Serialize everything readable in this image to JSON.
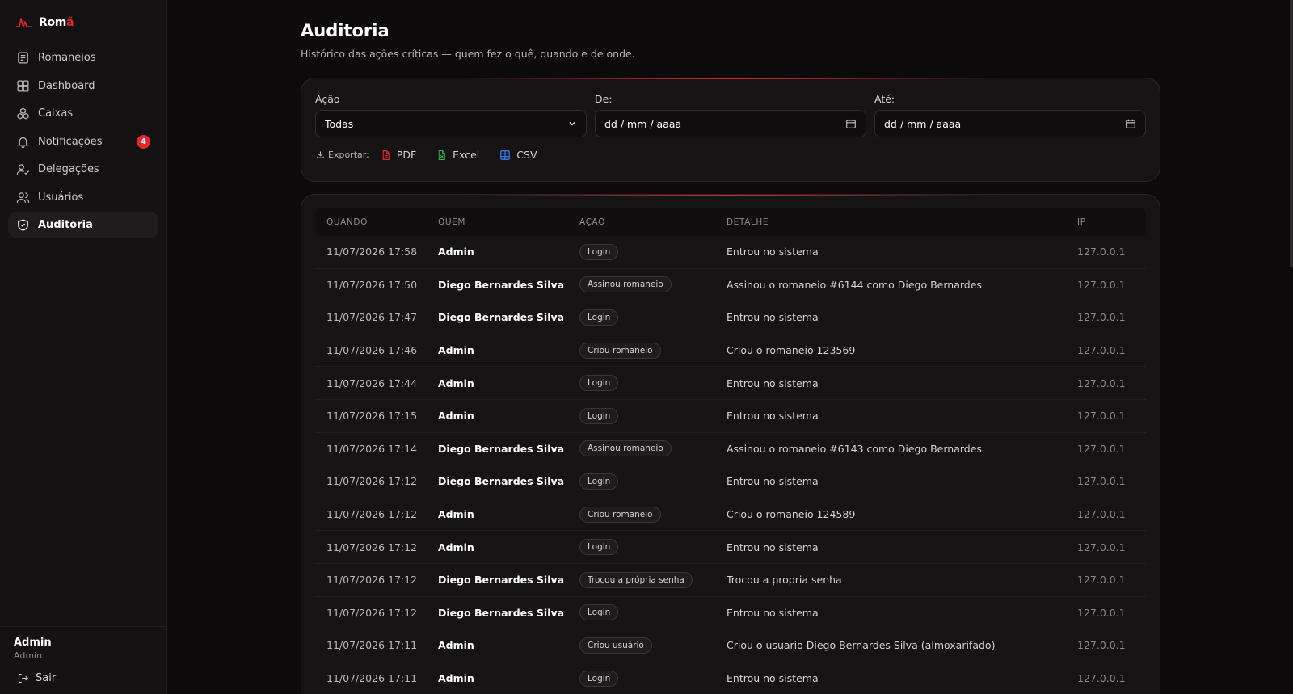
{
  "brand": {
    "name": "Rom",
    "accent_letter": "ã"
  },
  "sidebar": {
    "items": [
      {
        "label": "Romaneios",
        "icon": "receipt-icon"
      },
      {
        "label": "Dashboard",
        "icon": "dashboard-icon"
      },
      {
        "label": "Caixas",
        "icon": "boxes-icon"
      },
      {
        "label": "Notificações",
        "icon": "bell-icon",
        "badge": "4"
      },
      {
        "label": "Delegações",
        "icon": "user-check-icon"
      },
      {
        "label": "Usuários",
        "icon": "users-icon"
      },
      {
        "label": "Auditoria",
        "icon": "shield-icon",
        "active": true
      }
    ],
    "user": {
      "name": "Admin",
      "role": "Admin"
    },
    "logout_label": "Sair"
  },
  "page": {
    "title": "Auditoria",
    "subtitle": "Histórico das ações críticas — quem fez o quê, quando e de onde."
  },
  "filters": {
    "action_label": "Ação",
    "action_value": "Todas",
    "from_label": "De:",
    "from_placeholder": "dd / mm / aaaa",
    "to_label": "Até:",
    "to_placeholder": "dd / mm / aaaa",
    "export_label": "Exportar:",
    "export_pdf": "PDF",
    "export_excel": "Excel",
    "export_csv": "CSV"
  },
  "table": {
    "headers": [
      "QUANDO",
      "QUEM",
      "AÇÃO",
      "DETALHE",
      "IP"
    ],
    "rows": [
      [
        "11/07/2026 17:58",
        "Admin",
        "Login",
        "Entrou no sistema",
        "127.0.0.1"
      ],
      [
        "11/07/2026 17:50",
        "Diego Bernardes Silva",
        "Assinou romaneio",
        "Assinou o romaneio #6144 como Diego Bernardes",
        "127.0.0.1"
      ],
      [
        "11/07/2026 17:47",
        "Diego Bernardes Silva",
        "Login",
        "Entrou no sistema",
        "127.0.0.1"
      ],
      [
        "11/07/2026 17:46",
        "Admin",
        "Criou romaneio",
        "Criou o romaneio 123569",
        "127.0.0.1"
      ],
      [
        "11/07/2026 17:44",
        "Admin",
        "Login",
        "Entrou no sistema",
        "127.0.0.1"
      ],
      [
        "11/07/2026 17:15",
        "Admin",
        "Login",
        "Entrou no sistema",
        "127.0.0.1"
      ],
      [
        "11/07/2026 17:14",
        "Diego Bernardes Silva",
        "Assinou romaneio",
        "Assinou o romaneio #6143 como Diego Bernardes",
        "127.0.0.1"
      ],
      [
        "11/07/2026 17:12",
        "Diego Bernardes Silva",
        "Login",
        "Entrou no sistema",
        "127.0.0.1"
      ],
      [
        "11/07/2026 17:12",
        "Admin",
        "Criou romaneio",
        "Criou o romaneio 124589",
        "127.0.0.1"
      ],
      [
        "11/07/2026 17:12",
        "Admin",
        "Login",
        "Entrou no sistema",
        "127.0.0.1"
      ],
      [
        "11/07/2026 17:12",
        "Diego Bernardes Silva",
        "Trocou a própria senha",
        "Trocou a propria senha",
        "127.0.0.1"
      ],
      [
        "11/07/2026 17:12",
        "Diego Bernardes Silva",
        "Login",
        "Entrou no sistema",
        "127.0.0.1"
      ],
      [
        "11/07/2026 17:11",
        "Admin",
        "Criou usuário",
        "Criou o usuario Diego Bernardes Silva (almoxarifado)",
        "127.0.0.1"
      ],
      [
        "11/07/2026 17:11",
        "Admin",
        "Login",
        "Entrou no sistema",
        "127.0.0.1"
      ]
    ]
  },
  "colors": {
    "accent": "#e5262d",
    "background": "#0c0a0b",
    "card": "#161314"
  }
}
